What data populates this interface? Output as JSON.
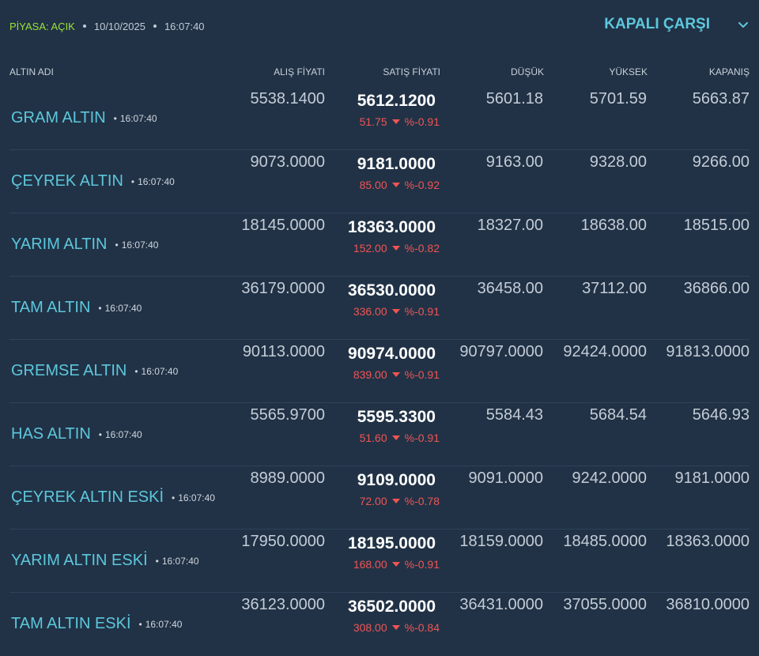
{
  "status": {
    "market": "PİYASA: AÇIK",
    "date": "10/10/2025",
    "time": "16:07:40"
  },
  "market_select": {
    "label": "KAPALI ÇARŞI",
    "icon": "chevron-down-icon"
  },
  "headers": {
    "name": "ALTIN ADI",
    "buy": "ALIŞ FİYATI",
    "sell": "SATIŞ FİYATI",
    "low": "DÜŞÜK",
    "high": "YÜKSEK",
    "close": "KAPANIŞ"
  },
  "colors": {
    "background": "#213246",
    "accent": "#5dc7dc",
    "open_status": "#9be23a",
    "down": "#f05454"
  },
  "rows": [
    {
      "name": "GRAM ALTIN",
      "time": "16:07:40",
      "buy": "5538.1400",
      "sell": "5612.1200",
      "change": "51.75",
      "pct": "%-0.91",
      "low": "5601.18",
      "high": "5701.59",
      "close": "5663.87"
    },
    {
      "name": "ÇEYREK ALTIN",
      "time": "16:07:40",
      "buy": "9073.0000",
      "sell": "9181.0000",
      "change": "85.00",
      "pct": "%-0.92",
      "low": "9163.00",
      "high": "9328.00",
      "close": "9266.00"
    },
    {
      "name": "YARIM ALTIN",
      "time": "16:07:40",
      "buy": "18145.0000",
      "sell": "18363.0000",
      "change": "152.00",
      "pct": "%-0.82",
      "low": "18327.00",
      "high": "18638.00",
      "close": "18515.00"
    },
    {
      "name": "TAM ALTIN",
      "time": "16:07:40",
      "buy": "36179.0000",
      "sell": "36530.0000",
      "change": "336.00",
      "pct": "%-0.91",
      "low": "36458.00",
      "high": "37112.00",
      "close": "36866.00"
    },
    {
      "name": "GREMSE ALTIN",
      "time": "16:07:40",
      "buy": "90113.0000",
      "sell": "90974.0000",
      "change": "839.00",
      "pct": "%-0.91",
      "low": "90797.0000",
      "high": "92424.0000",
      "close": "91813.0000"
    },
    {
      "name": "HAS ALTIN",
      "time": "16:07:40",
      "buy": "5565.9700",
      "sell": "5595.3300",
      "change": "51.60",
      "pct": "%-0.91",
      "low": "5584.43",
      "high": "5684.54",
      "close": "5646.93"
    },
    {
      "name": "ÇEYREK ALTIN ESKİ",
      "time": "16:07:40",
      "buy": "8989.0000",
      "sell": "9109.0000",
      "change": "72.00",
      "pct": "%-0.78",
      "low": "9091.0000",
      "high": "9242.0000",
      "close": "9181.0000"
    },
    {
      "name": "YARIM ALTIN ESKİ",
      "time": "16:07:40",
      "buy": "17950.0000",
      "sell": "18195.0000",
      "change": "168.00",
      "pct": "%-0.91",
      "low": "18159.0000",
      "high": "18485.0000",
      "close": "18363.0000"
    },
    {
      "name": "TAM ALTIN ESKİ",
      "time": "16:07:40",
      "buy": "36123.0000",
      "sell": "36502.0000",
      "change": "308.00",
      "pct": "%-0.84",
      "low": "36431.0000",
      "high": "37055.0000",
      "close": "36810.0000"
    }
  ]
}
